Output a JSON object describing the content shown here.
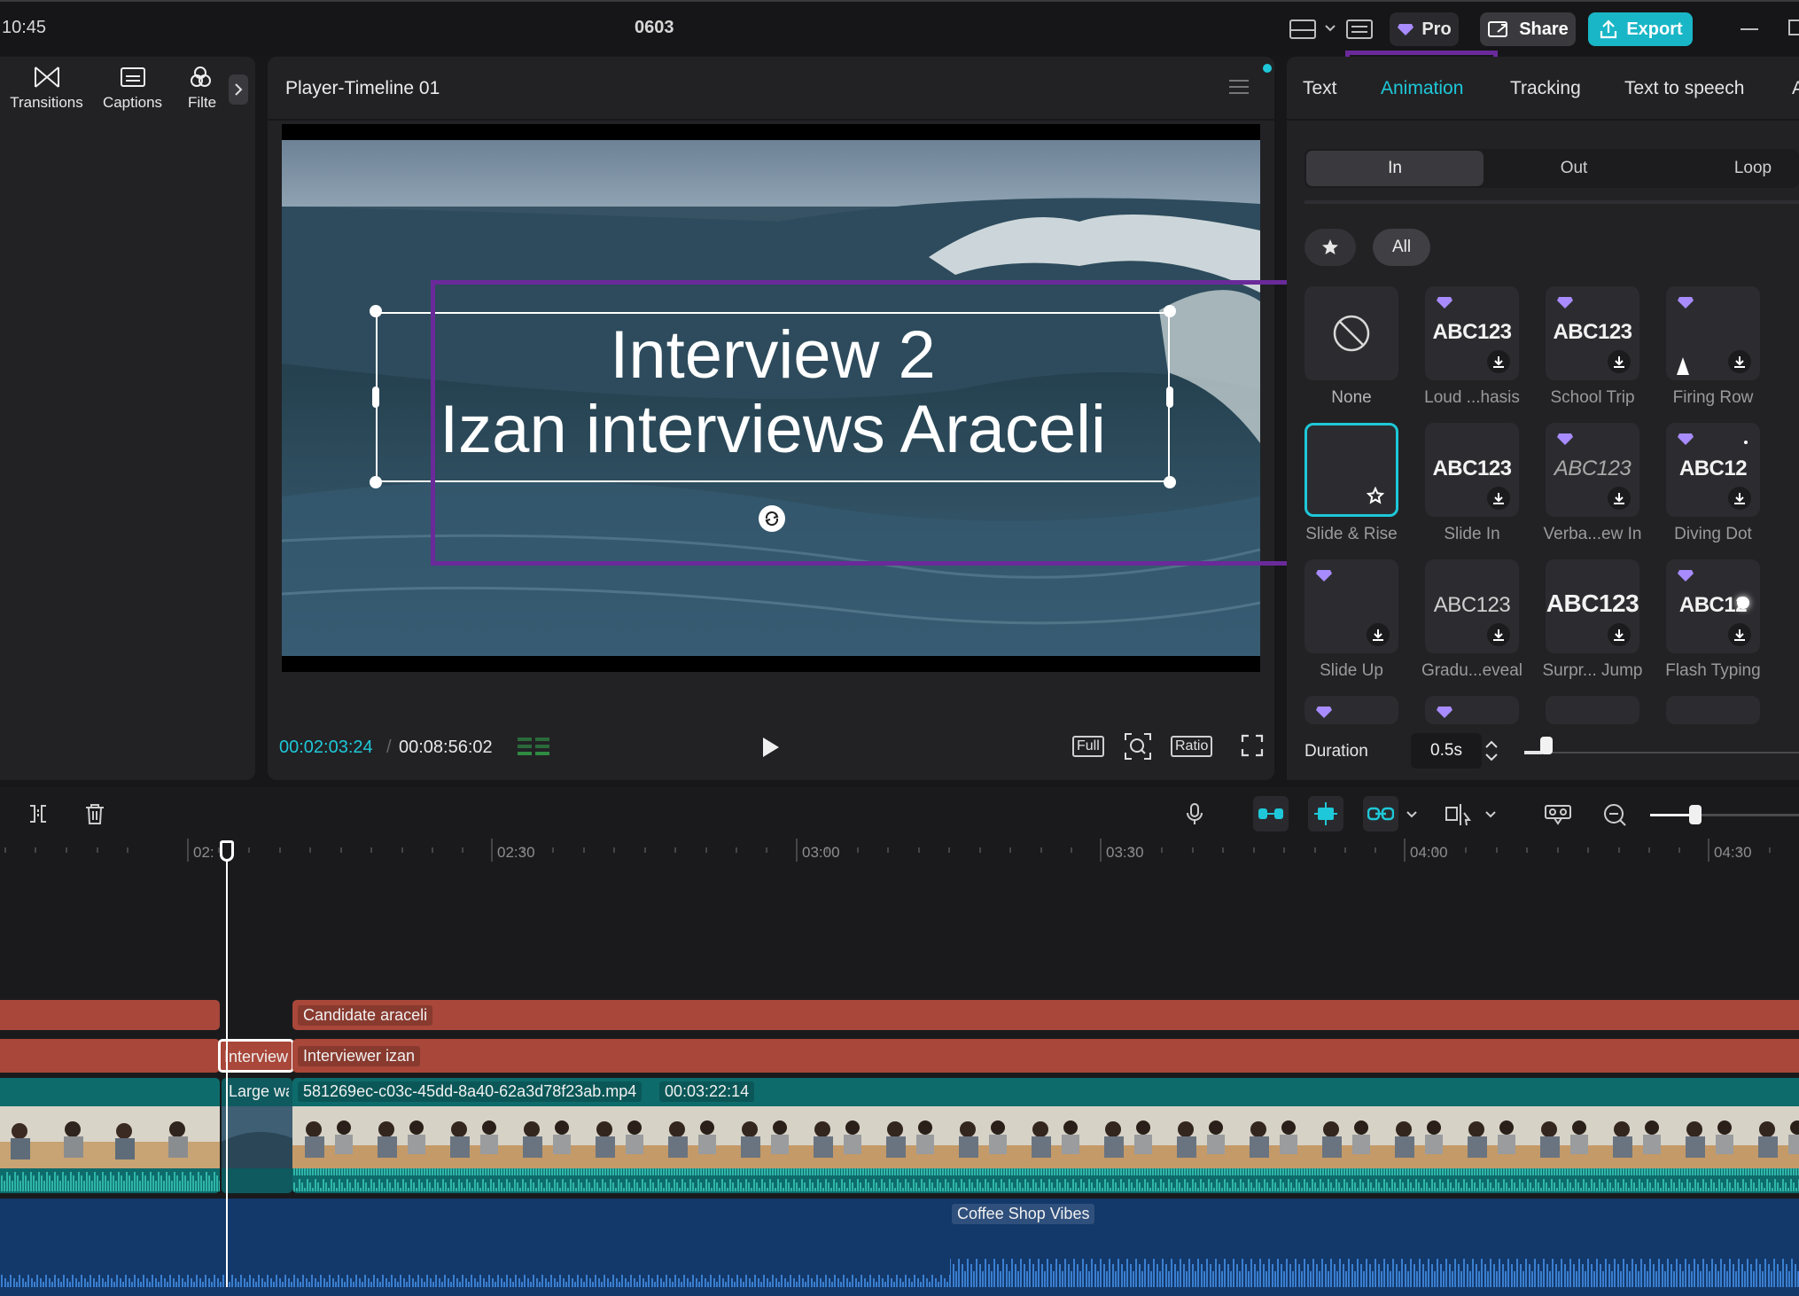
{
  "topbar": {
    "time": "10:45",
    "project_title": "0603",
    "pro_label": "Pro",
    "share_label": "Share",
    "export_label": "Export"
  },
  "toolbar": {
    "items": [
      {
        "label": "Transitions",
        "icon": "transitions-icon"
      },
      {
        "label": "Captions",
        "icon": "captions-icon"
      },
      {
        "label": "Filte",
        "icon": "filters-icon"
      }
    ]
  },
  "player": {
    "title": "Player-Timeline 01",
    "caption_line1": "Interview 2",
    "caption_line2": "Izan interviews Araceli",
    "current_time": "00:02:03:24",
    "separator": "/",
    "total_time": "00:08:56:02",
    "full_label": "Full",
    "ratio_label": "Ratio"
  },
  "inspector": {
    "tabs": [
      "Text",
      "Animation",
      "Tracking",
      "Text to speech"
    ],
    "active_tab": "Animation",
    "segments": [
      "In",
      "Out",
      "Loop"
    ],
    "active_segment": "In",
    "filter_all": "All",
    "cards": [
      {
        "name": "None",
        "preview": "",
        "pro": false,
        "download": false
      },
      {
        "name": "Loud ...hasis",
        "preview": "ABC123",
        "pro": true,
        "download": true
      },
      {
        "name": "School Trip",
        "preview": "ABC123",
        "pro": true,
        "download": true
      },
      {
        "name": "Firing Row",
        "preview": "",
        "pro": true,
        "download": true
      },
      {
        "name": "Slide & Rise",
        "preview": "",
        "pro": false,
        "download": false
      },
      {
        "name": "Slide In",
        "preview": "ABC123",
        "pro": false,
        "download": true
      },
      {
        "name": "Verba...ew In",
        "preview": "ABC123",
        "pro": true,
        "download": true
      },
      {
        "name": "Diving Dot",
        "preview": "ABC12",
        "pro": true,
        "download": true
      },
      {
        "name": "Slide Up",
        "preview": "",
        "pro": true,
        "download": true
      },
      {
        "name": "Gradu...eveal",
        "preview": "ABC123",
        "pro": false,
        "download": true
      },
      {
        "name": "Surpr... Jump",
        "preview": "ABC123",
        "pro": false,
        "download": true
      },
      {
        "name": "Flash Typing",
        "preview": "ABC12",
        "pro": true,
        "download": true
      }
    ],
    "duration_label": "Duration",
    "duration_value": "0.5s"
  },
  "timeline": {
    "ruler": [
      "02:",
      "02:30",
      "03:00",
      "03:30",
      "04:00",
      "04:30"
    ],
    "clips": {
      "candidate": "Candidate araceli",
      "interview_small": "Interview",
      "interviewer": "Interviewer izan",
      "large_wave": "Large wa",
      "video_file": "581269ec-c03c-45dd-8a40-62a3d78f23ab.mp4",
      "video_duration": "00:03:22:14",
      "music": "Coffee Shop Vibes"
    }
  },
  "colors": {
    "accent": "#1ec8d8",
    "highlight_box": "#6a2a9a",
    "text_clip": "#a8473a",
    "video_clip": "#0e6b6b",
    "audio_clip": "#13386a"
  }
}
